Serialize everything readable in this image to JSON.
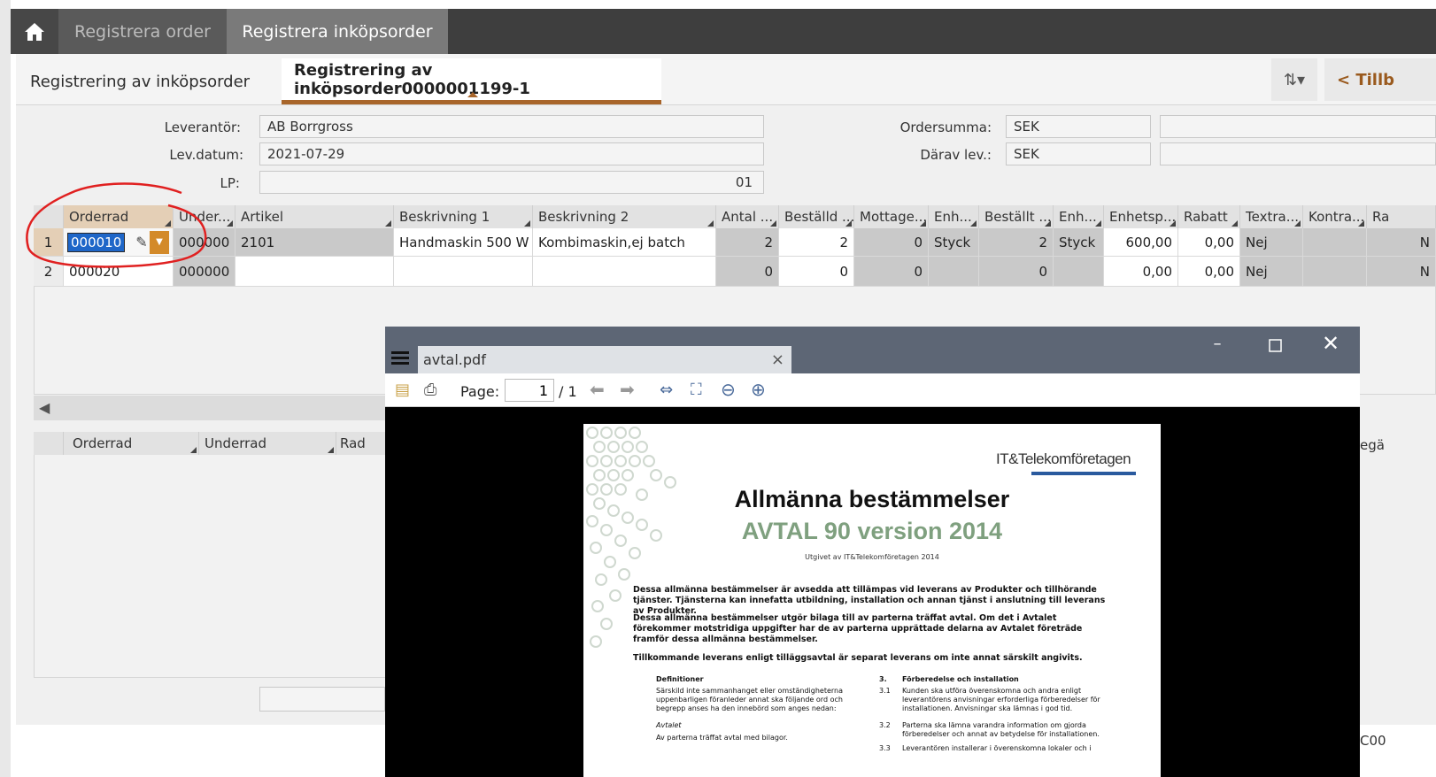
{
  "app": {
    "top_tabs": [
      "Registrera order",
      "Registrera inköpsorder"
    ],
    "sub_tabs": [
      "Registrering av inköpsorder",
      "Registrering av inköpsorder0000001199-1"
    ],
    "back_label": "< Tillb"
  },
  "form": {
    "leverantor_label": "Leverantör:",
    "leverantor_value": "AB Borrgross",
    "levdatum_label": "Lev.datum:",
    "levdatum_value": "2021-07-29",
    "lp_label": "LP:",
    "lp_value": "01",
    "ordersumma_label": "Ordersumma:",
    "ordersumma_value": "SEK",
    "darav_label": "Därav lev.:",
    "darav_value": "SEK"
  },
  "grid": {
    "columns": [
      "Orderrad",
      "Under...",
      "Artikel",
      "Beskrivning 1",
      "Beskrivning 2",
      "Antal ...",
      "Beställd ...",
      "Mottage...",
      "Enh...",
      "Beställt ...",
      "Enh...",
      "Enhetsp...",
      "Rabatt",
      "Textra...",
      "Kontra...",
      "Ra"
    ],
    "rows": [
      {
        "n": "1",
        "orderrad": "000010",
        "underrad": "000000",
        "artikel": "2101",
        "beskr1": "Handmaskin 500 W",
        "beskr2": "Kombimaskin,ej batch",
        "antal": "2",
        "bestalld": "2",
        "mottagen": "0",
        "enh1": "Styck",
        "bestallt": "2",
        "enh2": "Styck",
        "enhetspris": "600,00",
        "rabatt": "0,00",
        "textrad": "Nej",
        "extra": "N"
      },
      {
        "n": "2",
        "orderrad": "000020",
        "underrad": "000000",
        "artikel": "",
        "beskr1": "",
        "beskr2": "",
        "antal": "0",
        "bestalld": "0",
        "mottagen": "0",
        "enh1": "",
        "bestallt": "0",
        "enh2": "",
        "enhetspris": "0,00",
        "rabatt": "0,00",
        "textrad": "Nej",
        "extra": "N"
      }
    ]
  },
  "grid2": {
    "columns": [
      "Orderrad",
      "Underrad",
      "Rad"
    ],
    "right_cut": "egä"
  },
  "right_bottom_cut": "C00",
  "pdf": {
    "tab_title": "avtal.pdf",
    "page_label": "Page:",
    "page_current": "1",
    "page_total": "/ 1",
    "doc": {
      "brand": "IT&Telekomföretagen",
      "title": "Allmänna bestämmelser",
      "subtitle": "AVTAL 90 version 2014",
      "issued": "Utgivet av IT&Telekomföretagen 2014",
      "para1": "Dessa allmänna bestämmelser är avsedda att tillämpas vid leverans av Produkter och tillhörande tjänster. Tjänsterna kan innefatta utbildning, installation och annan tjänst i anslutning till leverans av Produkter.",
      "para2": "Dessa allmänna bestämmelser utgör bilaga till av parterna träffat avtal. Om det i Avtalet förekommer motstridiga uppgifter har de av parterna upprättade delarna av Avtalet företräde framför dessa allmänna bestämmelser.",
      "para3": "Tillkommande leverans enligt tilläggsavtal är separat leverans om inte annat särskilt angivits.",
      "col1_heading": "Definitioner",
      "col1_text": "Särskild inte sammanhanget eller omständigheterna uppenbarligen föranleder annat ska följande ord och begrepp anses ha den innebörd som anges nedan:",
      "col1_item": "Avtalet",
      "col1_item_text": "Av parterna träffat avtal med bilagor.",
      "col2_num": "3.",
      "col2_heading": "Förberedelse och installation",
      "col2_p1_num": "3.1",
      "col2_p1": "Kunden ska utföra överenskomna och andra enligt leverantörens anvisningar erforderliga förberedelser för installationen. Anvisningar ska lämnas i god tid.",
      "col2_p2_num": "3.2",
      "col2_p2": "Parterna ska lämna varandra information om gjorda förberedelser och annat av betydelse för installationen.",
      "col2_p3_num": "3.3",
      "col2_p3": "Leverantören installerar i överenskomna lokaler och i"
    }
  }
}
